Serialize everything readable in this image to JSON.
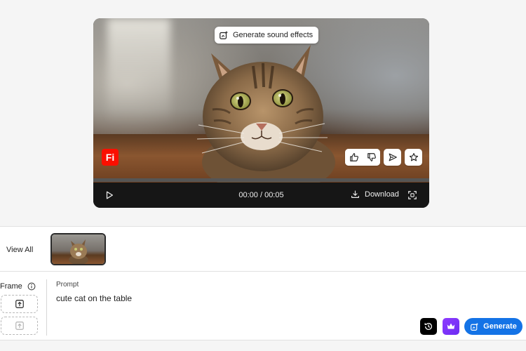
{
  "player": {
    "overlay_button_label": "Generate sound effects",
    "logo_text": "Fi",
    "logo_color": "#fa0f00",
    "feedback_icons": [
      "thumbs-up-icon",
      "thumbs-down-icon",
      "send-icon",
      "star-icon"
    ],
    "progress": 0,
    "time": "00:00 / 00:05",
    "download_label": "Download"
  },
  "gallery": {
    "view_all_label": "View All"
  },
  "prompt_panel": {
    "frame_label": "Frame",
    "prompt_label": "Prompt",
    "prompt_value": "cute cat on the table",
    "generate_label": "Generate",
    "accent_color": "#1473e6",
    "premium_color": "#7b33f5"
  }
}
